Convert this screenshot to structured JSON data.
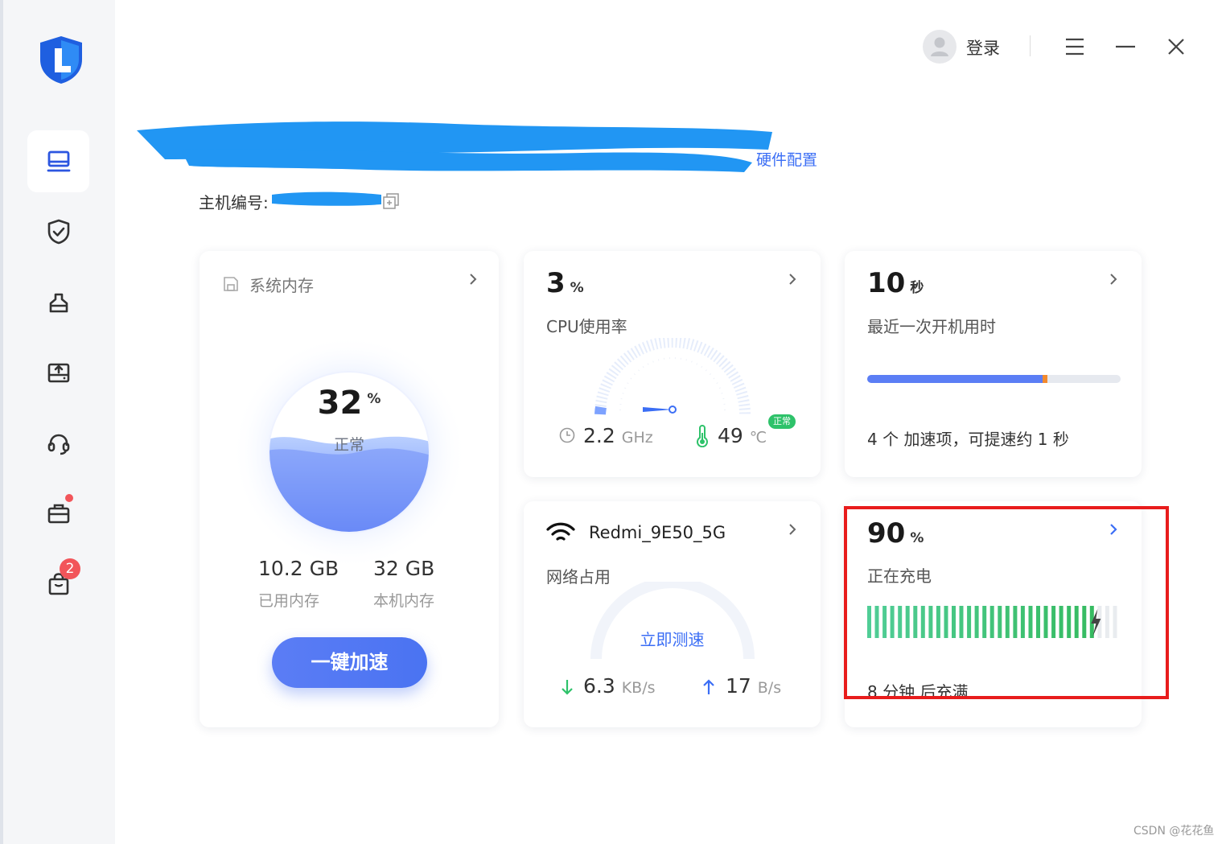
{
  "topbar": {
    "login_label": "登录"
  },
  "device": {
    "hardware_config_link": "硬件配置",
    "host_id_label": "主机编号:"
  },
  "memory_card": {
    "title": "系统内存",
    "percent": "32",
    "percent_unit": "%",
    "status": "正常",
    "used_value": "10.2 GB",
    "used_label": "已用内存",
    "total_value": "32 GB",
    "total_label": "本机内存",
    "boost_button": "一键加速",
    "fill_level": 0.32
  },
  "cpu_card": {
    "percent": "3",
    "percent_unit": "%",
    "label": "CPU使用率",
    "freq_value": "2.2",
    "freq_unit": "GHz",
    "temp_value": "49",
    "temp_unit": "℃",
    "temp_status": "正常",
    "gauge_level": 0.03
  },
  "boot_card": {
    "value": "10",
    "unit": "秒",
    "label": "最近一次开机用时",
    "progress": 0.71,
    "note": "4 个 加速项，可提速约 1 秒"
  },
  "network_card": {
    "ssid": "Redmi_9E50_5G",
    "label": "网络占用",
    "speedtest_button": "立即测速",
    "down_value": "6.3",
    "down_unit": "KB/s",
    "up_value": "17",
    "up_unit": "B/s"
  },
  "battery_card": {
    "percent": "90",
    "percent_unit": "%",
    "status": "正在充电",
    "level": 0.9,
    "eta": "8 分钟 后充满"
  },
  "footer": {
    "watermark": "CSDN @花花鱼"
  },
  "colors": {
    "accent": "#3b6ef5",
    "green": "#2ec26a",
    "red": "#e81c1c",
    "orange": "#f28a2e"
  },
  "sidebar": {
    "items": [
      "computer-icon",
      "shield-check-icon",
      "clean-icon",
      "upload-box-icon",
      "headset-icon",
      "toolbox-icon",
      "bag-icon"
    ],
    "bag_badge": "2"
  }
}
